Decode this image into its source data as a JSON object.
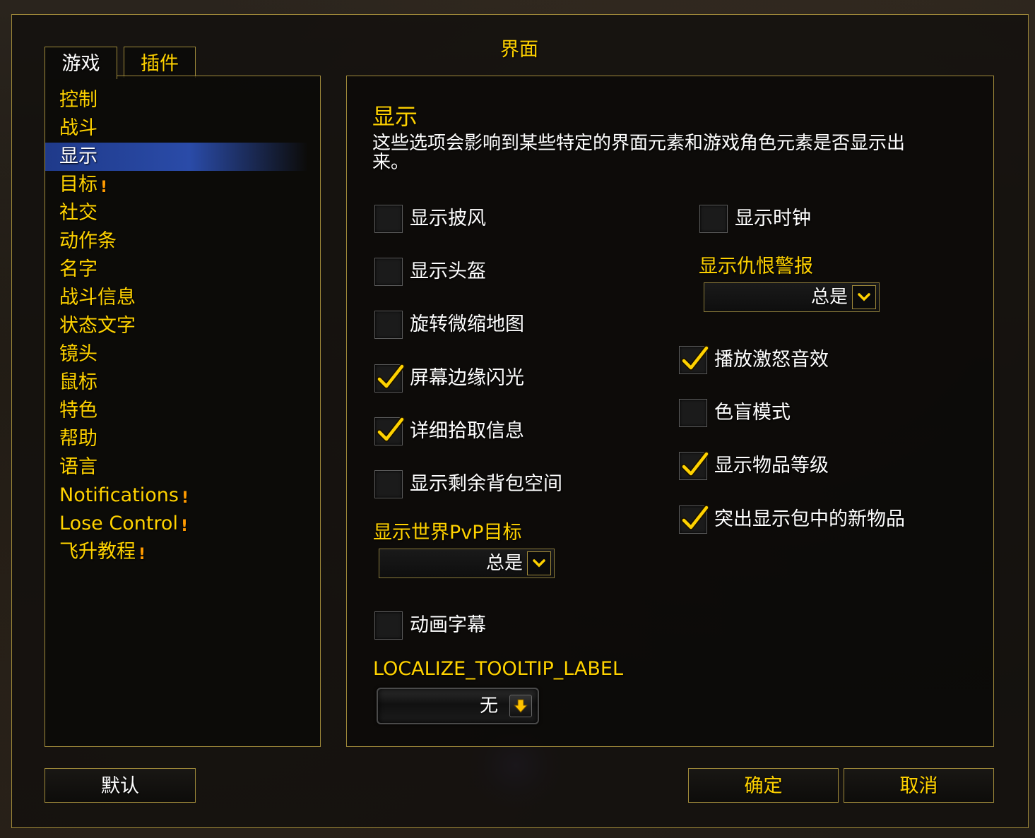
{
  "window_title": "界面",
  "tabs": [
    {
      "label": "游戏",
      "selected": true
    },
    {
      "label": "插件",
      "selected": false
    }
  ],
  "categories": [
    {
      "label": "控制",
      "warning": false
    },
    {
      "label": "战斗",
      "warning": false
    },
    {
      "label": "显示",
      "warning": false,
      "selected": true
    },
    {
      "label": "目标",
      "warning": true
    },
    {
      "label": "社交",
      "warning": false
    },
    {
      "label": "动作条",
      "warning": false
    },
    {
      "label": "名字",
      "warning": false
    },
    {
      "label": "战斗信息",
      "warning": false
    },
    {
      "label": "状态文字",
      "warning": false
    },
    {
      "label": "镜头",
      "warning": false
    },
    {
      "label": "鼠标",
      "warning": false
    },
    {
      "label": "特色",
      "warning": false
    },
    {
      "label": "帮助",
      "warning": false
    },
    {
      "label": "语言",
      "warning": false
    },
    {
      "label": "Notifications",
      "warning": true
    },
    {
      "label": "Lose Control",
      "warning": true
    },
    {
      "label": "飞升教程",
      "warning": true
    }
  ],
  "warning_glyph": "!",
  "section": {
    "title": "显示",
    "description": "这些选项会影响到某些特定的界面元素和游戏角色元素是否显示出来。"
  },
  "left_options": [
    {
      "label": "显示披风",
      "checked": false
    },
    {
      "label": "显示头盔",
      "checked": false
    },
    {
      "label": "旋转微缩地图",
      "checked": false
    },
    {
      "label": "屏幕边缘闪光",
      "checked": true
    },
    {
      "label": "详细拾取信息",
      "checked": true
    },
    {
      "label": "显示剩余背包空间",
      "checked": false
    }
  ],
  "pvp_target": {
    "label": "显示世界PvP目标",
    "value": "总是"
  },
  "cinematic_subtitles": {
    "label": "动画字幕",
    "checked": false
  },
  "tooltip_locale": {
    "label": "LOCALIZE_TOOLTIP_LABEL",
    "value": "无"
  },
  "clock": {
    "label": "显示时钟",
    "checked": false
  },
  "aggro_warning": {
    "label": "显示仇恨警报",
    "value": "总是"
  },
  "right_options": [
    {
      "label": "播放激怒音效",
      "checked": true
    },
    {
      "label": "色盲模式",
      "checked": false
    },
    {
      "label": "显示物品等级",
      "checked": true
    },
    {
      "label": "突出显示包中的新物品",
      "checked": true
    }
  ],
  "buttons": {
    "default": "默认",
    "ok": "确定",
    "cancel": "取消"
  },
  "colors": {
    "gold": "#ffd200",
    "border": "#a08a3a",
    "selection": "#2a4ba8",
    "warning": "#ff9a00"
  }
}
